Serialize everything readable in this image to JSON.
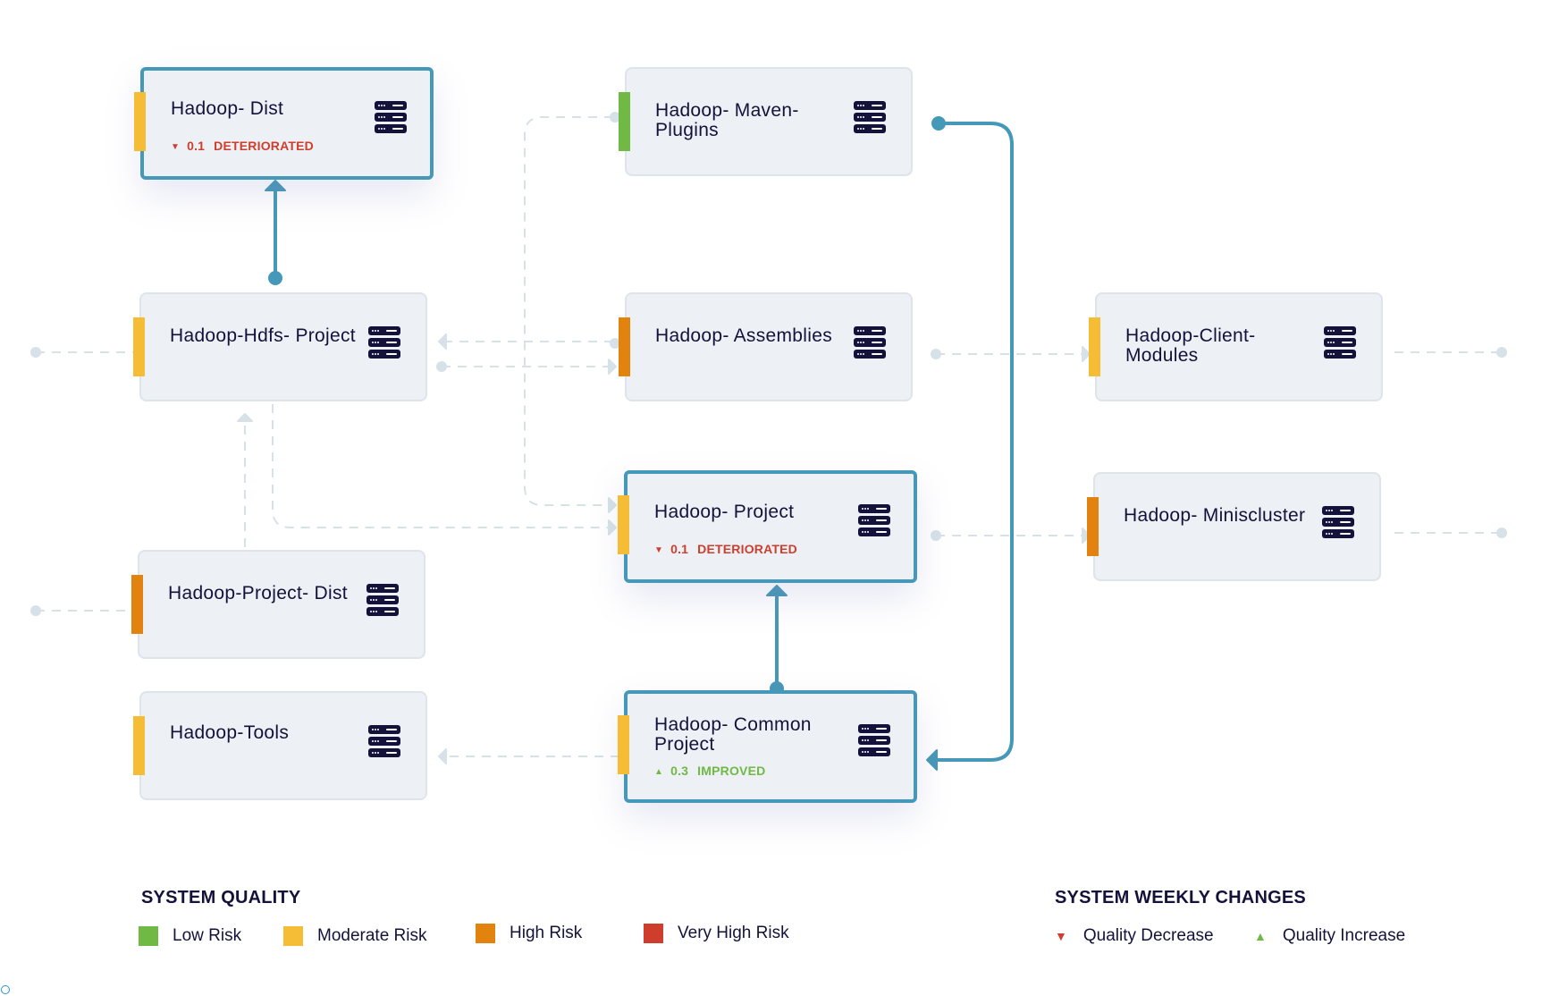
{
  "colors": {
    "low": "#6fb944",
    "moderate": "#f5bd35",
    "high": "#e2830f",
    "very_high": "#cf3e2c",
    "selected_border": "#4698b8",
    "dashed_line": "#d6e2e8",
    "decrease": "#cf3e2c",
    "increase": "#6fb944",
    "text": "#14123a"
  },
  "nodes": [
    {
      "id": "hadoop-dist",
      "title": "Hadoop- Dist",
      "risk": "moderate",
      "selected": true,
      "change": {
        "direction": "down",
        "value": "0.1",
        "label": "DETERIORATED"
      }
    },
    {
      "id": "hadoop-maven-plugins",
      "title": "Hadoop- Maven- Plugins",
      "risk": "low",
      "selected": false
    },
    {
      "id": "hadoop-hdfs-project",
      "title": "Hadoop-Hdfs- Project",
      "risk": "moderate",
      "selected": false
    },
    {
      "id": "hadoop-assemblies",
      "title": "Hadoop- Assemblies",
      "risk": "high",
      "selected": false
    },
    {
      "id": "hadoop-client-modules",
      "title": "Hadoop-Client- Modules",
      "risk": "moderate",
      "selected": false
    },
    {
      "id": "hadoop-project",
      "title": "Hadoop- Project",
      "risk": "moderate",
      "selected": true,
      "change": {
        "direction": "down",
        "value": "0.1",
        "label": "DETERIORATED"
      }
    },
    {
      "id": "hadoop-miniscluster",
      "title": "Hadoop- Miniscluster",
      "risk": "high",
      "selected": false
    },
    {
      "id": "hadoop-project-dist",
      "title": "Hadoop-Project- Dist",
      "risk": "high",
      "selected": false
    },
    {
      "id": "hadoop-tools",
      "title": "Hadoop-Tools",
      "risk": "moderate",
      "selected": false
    },
    {
      "id": "hadoop-common-project",
      "title": "Hadoop- Common Project",
      "risk": "moderate",
      "selected": true,
      "change": {
        "direction": "up",
        "value": "0.3",
        "label": "IMPROVED"
      }
    }
  ],
  "edges": [
    {
      "from": "hadoop-hdfs-project",
      "to": "hadoop-dist",
      "style": "solid"
    },
    {
      "from": "hadoop-common-project",
      "to": "hadoop-project",
      "style": "solid"
    },
    {
      "from": "hadoop-maven-plugins",
      "to": "hadoop-common-project",
      "style": "solid"
    },
    {
      "from": "hadoop-assemblies",
      "to": "hadoop-hdfs-project",
      "style": "dashed"
    },
    {
      "from": "hadoop-hdfs-project",
      "to": "hadoop-assemblies",
      "style": "dashed"
    },
    {
      "from": "hadoop-maven-plugins",
      "to": "hadoop-project",
      "style": "dashed"
    },
    {
      "from": "hadoop-hdfs-project",
      "to": "hadoop-project",
      "style": "dashed"
    },
    {
      "from": "hadoop-project-dist",
      "to": "hadoop-hdfs-project",
      "style": "dashed"
    },
    {
      "from": "hadoop-assemblies",
      "to": "hadoop-client-modules",
      "style": "dashed"
    },
    {
      "from": "hadoop-project",
      "to": "hadoop-miniscluster",
      "style": "dashed"
    },
    {
      "from": "hadoop-common-project",
      "to": "hadoop-tools",
      "style": "dashed"
    }
  ],
  "legend": {
    "quality": {
      "title": "SYSTEM QUALITY",
      "items": [
        {
          "label": "Low Risk",
          "risk": "low"
        },
        {
          "label": "Moderate Risk",
          "risk": "moderate"
        },
        {
          "label": "High Risk",
          "risk": "high"
        },
        {
          "label": "Very High Risk",
          "risk": "very_high"
        }
      ]
    },
    "changes": {
      "title": "SYSTEM WEEKLY CHANGES",
      "items": [
        {
          "label": "Quality Decrease",
          "direction": "down"
        },
        {
          "label": "Quality Increase",
          "direction": "up"
        }
      ]
    }
  }
}
